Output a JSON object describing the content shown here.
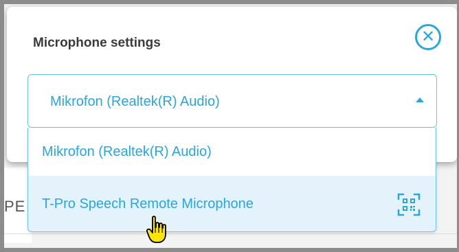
{
  "dialog": {
    "title": "Microphone settings",
    "close_icon": "close-circle-icon"
  },
  "microphone_select": {
    "selected": "Mikrofon (Realtek(R) Audio)",
    "arrow_icon": "caret-up-icon",
    "options": [
      {
        "label": "Mikrofon (Realtek(R) Audio)"
      },
      {
        "label": "T-Pro Speech Remote Microphone",
        "icon": "qr-code-icon",
        "hovered": true
      }
    ]
  },
  "background": {
    "partial_text": "PE"
  },
  "colors": {
    "accent": "#27a6df",
    "border": "#66c3ea",
    "hover": "#e3f2fb",
    "title": "#3a3a3a",
    "cursor": "#ffe600"
  },
  "cursor_icon": "hand-pointer-icon"
}
